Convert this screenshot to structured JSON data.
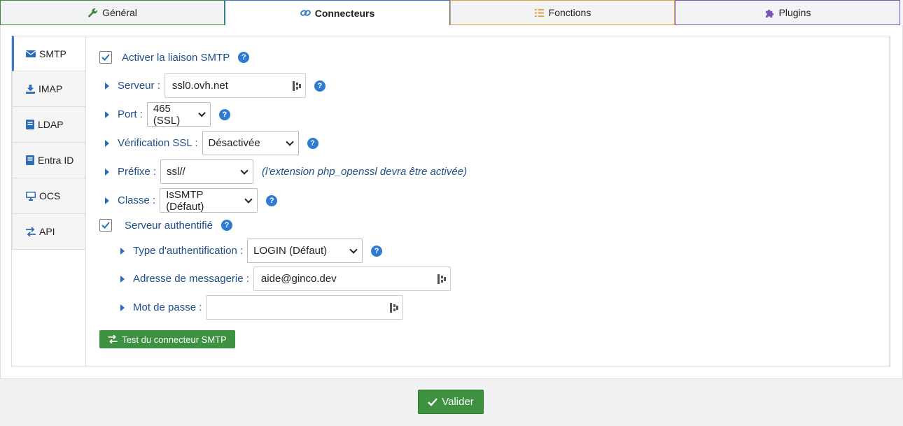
{
  "tabs": [
    {
      "label": "Général",
      "icon": "wrench-icon",
      "color": "#3a8a3a"
    },
    {
      "label": "Connecteurs",
      "icon": "link-icon",
      "color": "#3b79c2"
    },
    {
      "label": "Fonctions",
      "icon": "list-icon",
      "color": "#e0a03a"
    },
    {
      "label": "Plugins",
      "icon": "puzzle-icon",
      "color": "#7b55b5"
    }
  ],
  "sidebar": {
    "items": [
      {
        "label": "SMTP",
        "icon": "envelope-icon"
      },
      {
        "label": "IMAP",
        "icon": "download-icon"
      },
      {
        "label": "LDAP",
        "icon": "book-icon"
      },
      {
        "label": "Entra ID",
        "icon": "book-icon"
      },
      {
        "label": "OCS",
        "icon": "monitor-icon"
      },
      {
        "label": "API",
        "icon": "exchange-icon"
      }
    ]
  },
  "form": {
    "enable_smtp_label": "Activer la liaison SMTP",
    "server_label": "Serveur :",
    "server_value": "ssl0.ovh.net",
    "port_label": "Port :",
    "port_value": "465 (SSL)",
    "ssl_check_label": "Vérification SSL :",
    "ssl_check_value": "Désactivée",
    "prefix_label": "Préfixe :",
    "prefix_value": "ssl//",
    "prefix_note": "(l'extension php_openssl devra être activée)",
    "class_label": "Classe :",
    "class_value": "IsSMTP (Défaut)",
    "auth_server_label": "Serveur authentifié",
    "auth_type_label": "Type d'authentification :",
    "auth_type_value": "LOGIN (Défaut)",
    "email_label": "Adresse de messagerie :",
    "email_value": "aide@ginco.dev",
    "password_label": "Mot de passe :",
    "password_value": "",
    "help_glyph": "?",
    "test_button_label": "Test du connecteur SMTP"
  },
  "footer": {
    "submit_label": "Valider"
  },
  "colors": {
    "accent": "#3b79c2",
    "button_green": "#3d9140",
    "label_text": "#1d4f8a"
  }
}
